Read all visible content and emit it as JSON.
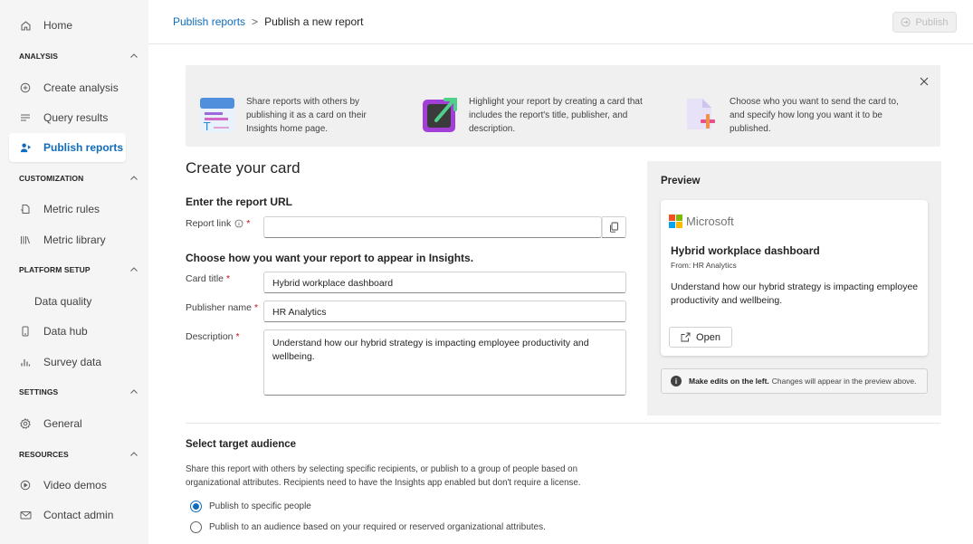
{
  "sidebar": {
    "home": "Home",
    "sections": {
      "analysis": "ANALYSIS",
      "customization": "CUSTOMIZATION",
      "platform": "PLATFORM SETUP",
      "settings": "SETTINGS",
      "resources": "RESOURCES"
    },
    "items": {
      "create_analysis": "Create analysis",
      "query_results": "Query results",
      "publish_reports": "Publish reports",
      "metric_rules": "Metric rules",
      "metric_library": "Metric library",
      "data_quality": "Data quality",
      "data_hub": "Data hub",
      "survey_data": "Survey data",
      "general": "General",
      "video_demos": "Video demos",
      "contact_admin": "Contact admin"
    }
  },
  "header": {
    "breadcrumb_parent": "Publish reports",
    "breadcrumb_separator": ">",
    "breadcrumb_current": "Publish a new report",
    "publish_label": "Publish"
  },
  "banner": {
    "items": [
      "Share reports with others by publishing it as a card on their Insights home page.",
      "Highlight your report by creating a card that includes the report's title, publisher, and description.",
      "Choose who you want to send the card to, and specify how long you want it to be published."
    ]
  },
  "form": {
    "heading": "Create your card",
    "url_section": "Enter the report URL",
    "report_link_label": "Report link",
    "report_link_value": "",
    "appear_section": "Choose how you want your report to appear in Insights.",
    "card_title_label": "Card title",
    "card_title_value": "Hybrid workplace dashboard",
    "publisher_label": "Publisher name",
    "publisher_value": "HR Analytics",
    "description_label": "Description",
    "description_value": "Understand how our hybrid strategy is impacting employee productivity and wellbeing.",
    "required_mark": "*"
  },
  "preview": {
    "heading": "Preview",
    "brand": "Microsoft",
    "title": "Hybrid workplace dashboard",
    "from": "From: HR Analytics",
    "description": "Understand how our hybrid strategy is impacting employee productivity and wellbeing.",
    "open_label": "Open",
    "info_bold": "Make edits on the left.",
    "info_text": "Changes will appear in the preview above."
  },
  "audience": {
    "title": "Select target audience",
    "description": "Share this report with others by selecting specific recipients, or publish to a group of people based on organizational attributes. Recipients need to have the Insights app enabled but don't require a license.",
    "option_specific": "Publish to specific people",
    "option_attributes": "Publish to an audience based on your required or reserved organizational attributes.",
    "selected": "specific"
  },
  "colors": {
    "accent": "#0f6cbd",
    "required": "#c50f1f"
  }
}
